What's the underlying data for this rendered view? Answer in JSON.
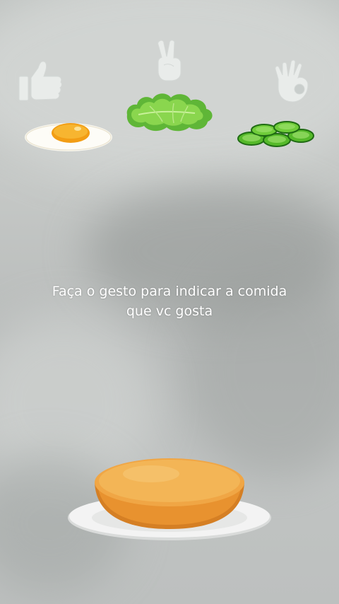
{
  "instruction": {
    "line1": "Faça o gesto para indicar a comida",
    "line2": "que vc gosta"
  },
  "options": [
    {
      "food": "fried-egg",
      "gesture": "thumbs-up-icon"
    },
    {
      "food": "lettuce",
      "gesture": "peace-sign-icon"
    },
    {
      "food": "cucumber-slices",
      "gesture": "ok-hand-icon"
    }
  ],
  "colors": {
    "gesture_icon": "#e9ecea",
    "bun": "#e8922f",
    "plate": "#f3f3f3",
    "text": "#ffffff"
  }
}
